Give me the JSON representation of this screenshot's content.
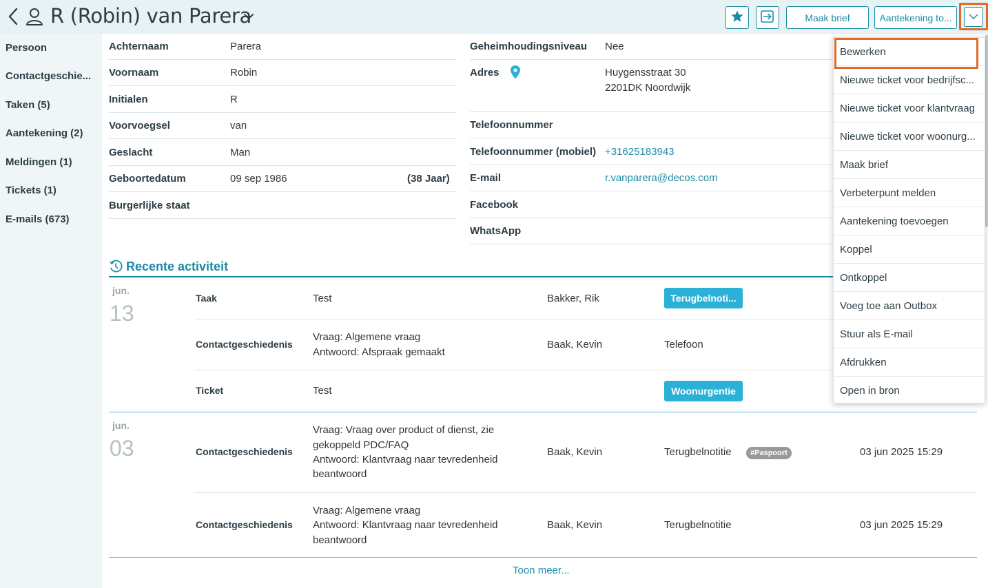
{
  "header": {
    "title": "R (Robin) van Parera",
    "brief_label": "Maak brief",
    "note_label": "Aantekening to..."
  },
  "sidebar": {
    "items": [
      {
        "label": "Persoon"
      },
      {
        "label": "Contactgeschie..."
      },
      {
        "label": "Taken (5)"
      },
      {
        "label": "Aantekening (2)"
      },
      {
        "label": "Meldingen (1)"
      },
      {
        "label": "Tickets (1)"
      },
      {
        "label": "E-mails (673)"
      }
    ]
  },
  "fields_left": [
    {
      "label": "Achternaam",
      "value": "Parera"
    },
    {
      "label": "Voornaam",
      "value": "Robin"
    },
    {
      "label": "Initialen",
      "value": "R"
    },
    {
      "label": "Voorvoegsel",
      "value": "van"
    },
    {
      "label": "Geslacht",
      "value": "Man"
    },
    {
      "label": "Geboortedatum",
      "value": "09 sep 1986",
      "extra": "(38 Jaar)"
    },
    {
      "label": "Burgerlijke staat",
      "value": ""
    }
  ],
  "fields_right": {
    "secrecy": {
      "label": "Geheimhoudingsniveau",
      "value": "Nee"
    },
    "address": {
      "label": "Adres",
      "line1": "Huygensstraat 30",
      "line2": "2201DK Noordwijk"
    },
    "phone": {
      "label": "Telefoonnummer",
      "value": ""
    },
    "mobile": {
      "label": "Telefoonnummer (mobiel)",
      "value": "+31625183943"
    },
    "email": {
      "label": "E-mail",
      "value": "r.vanparera@decos.com"
    },
    "facebook": {
      "label": "Facebook",
      "value": ""
    },
    "whatsapp": {
      "label": "WhatsApp",
      "value": ""
    }
  },
  "activity": {
    "title": "Recente activiteit",
    "groups": [
      {
        "month": "jun.",
        "day": "13"
      },
      {
        "month": "jun.",
        "day": "03"
      }
    ],
    "rows": [
      {
        "type": "Taak",
        "desc": "Test",
        "who": "Bakker, Rik",
        "badge": "Terugbelnoti..."
      },
      {
        "type": "Contactgeschiedenis",
        "desc1": "Vraag: Algemene vraag",
        "desc2": "Antwoord: Afspraak gemaakt",
        "who": "Baak, Kevin",
        "category": "Telefoon"
      },
      {
        "type": "Ticket",
        "desc": "Test",
        "badge": "Woonurgentie"
      },
      {
        "type": "Contactgeschiedenis",
        "desc1": "Vraag: Vraag over product of dienst, zie",
        "desc2": "gekoppeld PDC/FAQ",
        "desc3": "Antwoord: Klantvraag naar tevredenheid",
        "desc4": "beantwoord",
        "who": "Baak, Kevin",
        "category": "Terugbelnotitie",
        "tag": "#Paspoort",
        "date": "03 jun 2025 15:29"
      },
      {
        "type": "Contactgeschiedenis",
        "desc1": "Vraag: Algemene vraag",
        "desc2": "Antwoord: Klantvraag naar tevredenheid",
        "desc3": "beantwoord",
        "who": "Baak, Kevin",
        "category": "Terugbelnotitie",
        "date": "03 jun 2025 15:29"
      }
    ],
    "more_label": "Toon meer..."
  },
  "menu": {
    "items": [
      "Bewerken",
      "Nieuwe ticket voor bedrijfsc...",
      "Nieuwe ticket voor klantvraag",
      "Nieuwe ticket voor woonurg...",
      "Maak brief",
      "Verbeterpunt melden",
      "Aantekening toevoegen",
      "Koppel",
      "Ontkoppel",
      "Voeg toe aan Outbox",
      "Stuur als E-mail",
      "Afdrukken",
      "Open in bron"
    ]
  },
  "colors": {
    "accent": "#1a8ba6",
    "highlight": "#e06a2a",
    "badge": "#2bb0d8"
  },
  "icons": [
    "back-icon",
    "person-icon",
    "chevron-down-icon",
    "star-icon",
    "exit-icon",
    "location-pin-icon",
    "clock-history-icon"
  ]
}
